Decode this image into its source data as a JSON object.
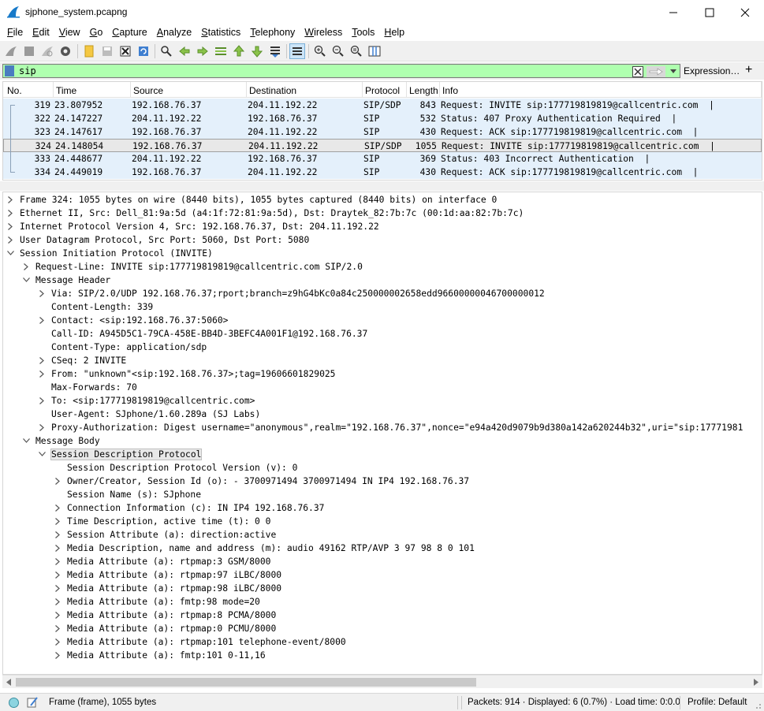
{
  "window": {
    "title": "sjphone_system.pcapng"
  },
  "menu": [
    "File",
    "Edit",
    "View",
    "Go",
    "Capture",
    "Analyze",
    "Statistics",
    "Telephony",
    "Wireless",
    "Tools",
    "Help"
  ],
  "filter": {
    "value": "sip",
    "expression_label": "Expression…",
    "plus_label": "+"
  },
  "packet_list": {
    "columns": [
      "No.",
      "Time",
      "Source",
      "Destination",
      "Protocol",
      "Length",
      "Info"
    ],
    "rows": [
      {
        "no": "319",
        "time": "23.807952",
        "src": "192.168.76.37",
        "dst": "204.11.192.22",
        "proto": "SIP/SDP",
        "len": "843",
        "info": "Request: INVITE sip:177719819819@callcentric.com  |"
      },
      {
        "no": "322",
        "time": "24.147227",
        "src": "204.11.192.22",
        "dst": "192.168.76.37",
        "proto": "SIP",
        "len": "532",
        "info": "Status: 407 Proxy Authentication Required  |"
      },
      {
        "no": "323",
        "time": "24.147617",
        "src": "192.168.76.37",
        "dst": "204.11.192.22",
        "proto": "SIP",
        "len": "430",
        "info": "Request: ACK sip:177719819819@callcentric.com  |"
      },
      {
        "no": "324",
        "time": "24.148054",
        "src": "192.168.76.37",
        "dst": "204.11.192.22",
        "proto": "SIP/SDP",
        "len": "1055",
        "info": "Request: INVITE sip:177719819819@callcentric.com  |"
      },
      {
        "no": "333",
        "time": "24.448677",
        "src": "204.11.192.22",
        "dst": "192.168.76.37",
        "proto": "SIP",
        "len": "369",
        "info": "Status: 403 Incorrect Authentication  |"
      },
      {
        "no": "334",
        "time": "24.449019",
        "src": "192.168.76.37",
        "dst": "204.11.192.22",
        "proto": "SIP",
        "len": "430",
        "info": "Request: ACK sip:177719819819@callcentric.com  |"
      }
    ],
    "selected_no": "324"
  },
  "details": [
    {
      "level": 0,
      "exp": "collapsed",
      "text": "Frame 324: 1055 bytes on wire (8440 bits), 1055 bytes captured (8440 bits) on interface 0"
    },
    {
      "level": 0,
      "exp": "collapsed",
      "text": "Ethernet II, Src: Dell_81:9a:5d (a4:1f:72:81:9a:5d), Dst: Draytek_82:7b:7c (00:1d:aa:82:7b:7c)"
    },
    {
      "level": 0,
      "exp": "collapsed",
      "text": "Internet Protocol Version 4, Src: 192.168.76.37, Dst: 204.11.192.22"
    },
    {
      "level": 0,
      "exp": "collapsed",
      "text": "User Datagram Protocol, Src Port: 5060, Dst Port: 5080"
    },
    {
      "level": 0,
      "exp": "expanded",
      "text": "Session Initiation Protocol (INVITE)"
    },
    {
      "level": 1,
      "exp": "collapsed",
      "text": "Request-Line: INVITE sip:177719819819@callcentric.com SIP/2.0"
    },
    {
      "level": 1,
      "exp": "expanded",
      "text": "Message Header"
    },
    {
      "level": 2,
      "exp": "collapsed",
      "text": "Via: SIP/2.0/UDP 192.168.76.37;rport;branch=z9hG4bKc0a84c250000002658edd96600000046700000012"
    },
    {
      "level": 2,
      "exp": "none",
      "text": "Content-Length: 339"
    },
    {
      "level": 2,
      "exp": "collapsed",
      "text": "Contact: <sip:192.168.76.37:5060>"
    },
    {
      "level": 2,
      "exp": "none",
      "text": "Call-ID: A945D5C1-79CA-458E-BB4D-3BEFC4A001F1@192.168.76.37"
    },
    {
      "level": 2,
      "exp": "none",
      "text": "Content-Type: application/sdp"
    },
    {
      "level": 2,
      "exp": "collapsed",
      "text": "CSeq: 2 INVITE"
    },
    {
      "level": 2,
      "exp": "collapsed",
      "text": "From: \"unknown\"<sip:192.168.76.37>;tag=19606601829025"
    },
    {
      "level": 2,
      "exp": "none",
      "text": "Max-Forwards: 70"
    },
    {
      "level": 2,
      "exp": "collapsed",
      "text": "To: <sip:177719819819@callcentric.com>"
    },
    {
      "level": 2,
      "exp": "none",
      "text": "User-Agent: SJphone/1.60.289a (SJ Labs)"
    },
    {
      "level": 2,
      "exp": "collapsed",
      "text": "Proxy-Authorization: Digest username=\"anonymous\",realm=\"192.168.76.37\",nonce=\"e94a420d9079b9d380a142a620244b32\",uri=\"sip:17771981"
    },
    {
      "level": 1,
      "exp": "expanded",
      "text": "Message Body"
    },
    {
      "level": 2,
      "exp": "expanded",
      "text": "Session Description Protocol",
      "hl": true
    },
    {
      "level": 3,
      "exp": "none",
      "text": "Session Description Protocol Version (v): 0"
    },
    {
      "level": 3,
      "exp": "collapsed",
      "text": "Owner/Creator, Session Id (o): - 3700971494 3700971494 IN IP4 192.168.76.37"
    },
    {
      "level": 3,
      "exp": "none",
      "text": "Session Name (s): SJphone"
    },
    {
      "level": 3,
      "exp": "collapsed",
      "text": "Connection Information (c): IN IP4 192.168.76.37"
    },
    {
      "level": 3,
      "exp": "collapsed",
      "text": "Time Description, active time (t): 0 0"
    },
    {
      "level": 3,
      "exp": "collapsed",
      "text": "Session Attribute (a): direction:active"
    },
    {
      "level": 3,
      "exp": "collapsed",
      "text": "Media Description, name and address (m): audio 49162 RTP/AVP 3 97 98 8 0 101"
    },
    {
      "level": 3,
      "exp": "collapsed",
      "text": "Media Attribute (a): rtpmap:3 GSM/8000"
    },
    {
      "level": 3,
      "exp": "collapsed",
      "text": "Media Attribute (a): rtpmap:97 iLBC/8000"
    },
    {
      "level": 3,
      "exp": "collapsed",
      "text": "Media Attribute (a): rtpmap:98 iLBC/8000"
    },
    {
      "level": 3,
      "exp": "collapsed",
      "text": "Media Attribute (a): fmtp:98 mode=20"
    },
    {
      "level": 3,
      "exp": "collapsed",
      "text": "Media Attribute (a): rtpmap:8 PCMA/8000"
    },
    {
      "level": 3,
      "exp": "collapsed",
      "text": "Media Attribute (a): rtpmap:0 PCMU/8000"
    },
    {
      "level": 3,
      "exp": "collapsed",
      "text": "Media Attribute (a): rtpmap:101 telephone-event/8000"
    },
    {
      "level": 3,
      "exp": "collapsed",
      "text": "Media Attribute (a): fmtp:101 0-11,16"
    }
  ],
  "status": {
    "frame": "Frame (frame), 1055 bytes",
    "packets": "Packets: 914 · Displayed: 6 (0.7%) · Load time: 0:0.0",
    "profile": "Profile: Default"
  },
  "colors": {
    "filter_ok": "#afffaf",
    "sip_row": "#e4f0fb",
    "selected_row": "#e8e8e8"
  }
}
